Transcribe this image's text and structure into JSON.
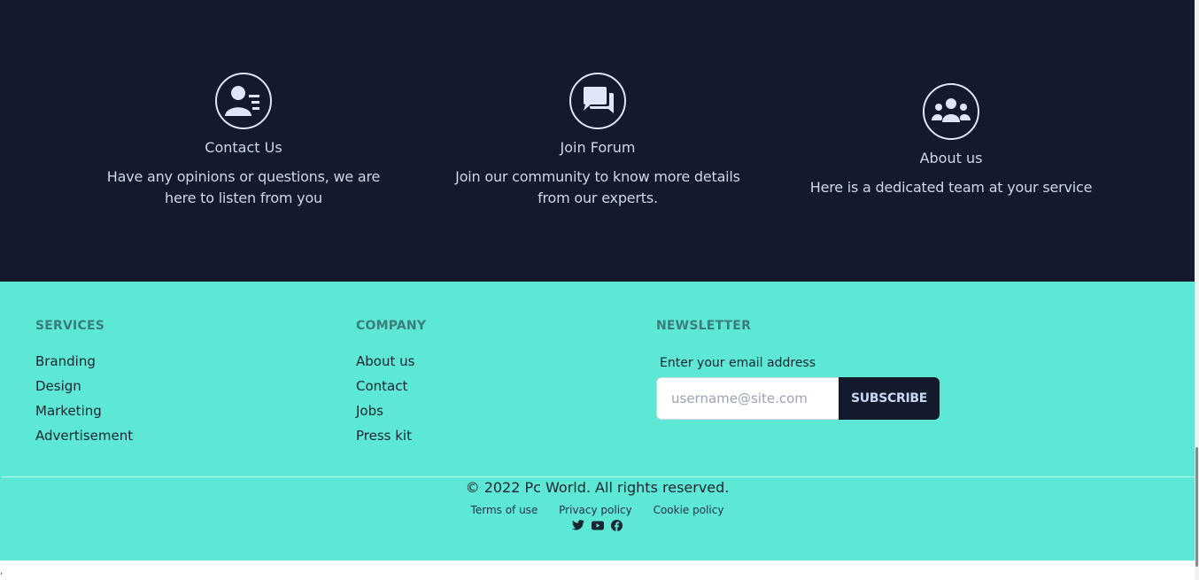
{
  "features": [
    {
      "icon": "contact-card-icon",
      "title": "Contact Us",
      "desc_line1": "Have any opinions or questions, we are",
      "desc_line2": "here to listen from you"
    },
    {
      "icon": "chat-bubbles-icon",
      "title": "Join Forum",
      "desc_line1": "Join our community to know more details",
      "desc_line2": "from our experts."
    },
    {
      "icon": "team-icon",
      "title": "About us",
      "desc_line1": "Here is a dedicated team at your service",
      "desc_line2": ""
    }
  ],
  "footer": {
    "services": {
      "title": "SERVICES",
      "items": [
        "Branding",
        "Design",
        "Marketing",
        "Advertisement"
      ]
    },
    "company": {
      "title": "COMPANY",
      "items": [
        "About us",
        "Contact",
        "Jobs",
        "Press kit"
      ]
    },
    "newsletter": {
      "title": "NEWSLETTER",
      "label": "Enter your email address",
      "placeholder": "username@site.com",
      "value": "",
      "button": "SUBSCRIBE"
    },
    "copyright": "© 2022 Pc World. All rights reserved.",
    "legal": [
      "Terms of use",
      "Privacy policy",
      "Cookie policy"
    ],
    "social": [
      "twitter-icon",
      "youtube-icon",
      "facebook-icon"
    ]
  },
  "colors": {
    "dark": "#131a2b",
    "teal": "#5ce8d4",
    "heading": "#3b7d7a"
  },
  "stray_mark": ","
}
